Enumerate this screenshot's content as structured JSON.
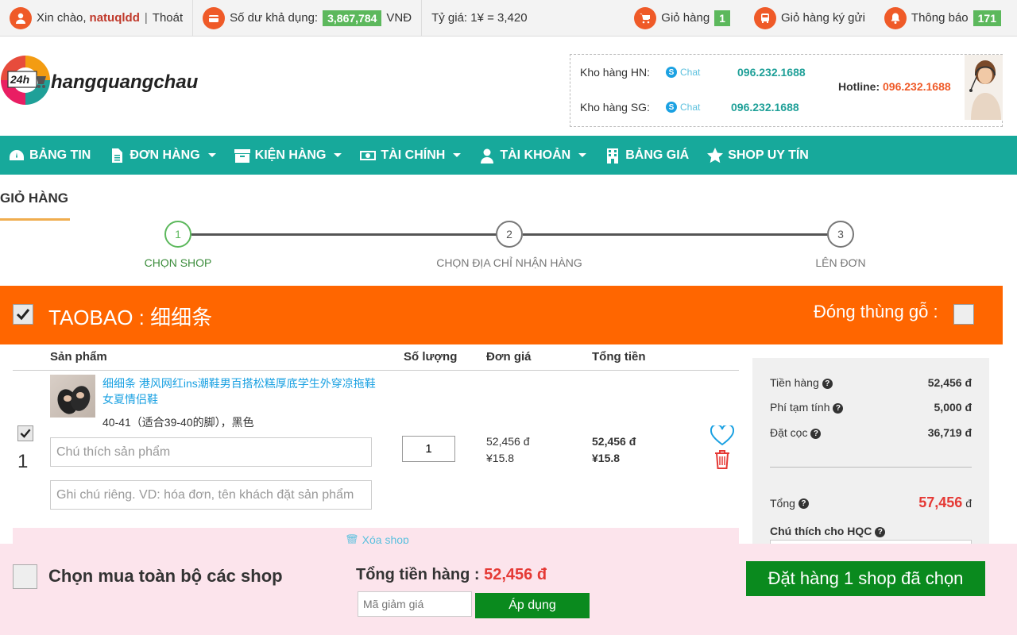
{
  "topbar": {
    "greeting": "Xin chào,",
    "username": "natuqldd",
    "logout": "Thoát",
    "balance_label": "Số dư khả dụng:",
    "balance_value": "3,867,784",
    "balance_unit": "VNĐ",
    "rate": "Tỷ giá: 1¥ = 3,420",
    "cart_label": "Giỏ hàng",
    "cart_count": "1",
    "consign_cart_label": "Giỏ hàng ký gửi",
    "notify_label": "Thông báo",
    "notify_count": "171"
  },
  "header": {
    "logo_badge": "24h",
    "logo_text": "hangquangchau",
    "kho_hn_label": "Kho hàng HN:",
    "kho_sg_label": "Kho hàng SG:",
    "chat_label": "Chat",
    "phone_hn": "096.232.1688",
    "phone_sg": "096.232.1688",
    "hotline_label": "Hotline:",
    "hotline_value": "096.232.1688"
  },
  "nav": {
    "items": [
      {
        "label": "BẢNG TIN",
        "icon": "dashboard-icon",
        "dropdown": false
      },
      {
        "label": "ĐƠN HÀNG",
        "icon": "document-icon",
        "dropdown": true
      },
      {
        "label": "KIỆN HÀNG",
        "icon": "box-icon",
        "dropdown": true
      },
      {
        "label": "TÀI CHÍNH",
        "icon": "money-icon",
        "dropdown": true
      },
      {
        "label": "TÀI KHOẢN",
        "icon": "user-icon",
        "dropdown": true
      },
      {
        "label": "BẢNG GIÁ",
        "icon": "building-icon",
        "dropdown": false
      },
      {
        "label": "SHOP UY TÍN",
        "icon": "star-icon",
        "dropdown": false
      }
    ]
  },
  "page": {
    "title": "GIỎ HÀNG"
  },
  "steps": [
    {
      "num": "1",
      "label": "CHỌN SHOP",
      "active": true
    },
    {
      "num": "2",
      "label": "CHỌN ĐỊA CHỈ NHẬN HÀNG",
      "active": false
    },
    {
      "num": "3",
      "label": "LÊN ĐƠN",
      "active": false
    }
  ],
  "shop": {
    "name": "TAOBAO : 细细条",
    "wood_label": "Đóng thùng gỗ :",
    "delete_label": "🗑 Xóa shop"
  },
  "table": {
    "col_product": "Sản phẩm",
    "col_qty": "Số lượng",
    "col_price": "Đơn giá",
    "col_total": "Tổng tiền"
  },
  "item": {
    "index": "1",
    "name": "细细条 港风网红ins潮鞋男百搭松糕厚底学生外穿凉拖鞋女夏情侣鞋",
    "variant": "40-41（适合39-40的脚），黑色",
    "note_placeholder": "Chú thích sản phẩm",
    "private_note_placeholder": "Ghi chú riêng. VD: hóa đơn, tên khách đặt sản phẩm",
    "qty": "1",
    "price_vnd": "52,456 đ",
    "price_cny": "¥15.8",
    "total_vnd": "52,456 đ",
    "total_cny": "¥15.8"
  },
  "summary": {
    "goods_label": "Tiền hàng",
    "goods_value": "52,456 đ",
    "fee_label": "Phí tạm tính",
    "fee_value": "5,000 đ",
    "deposit_label": "Đặt cọc",
    "deposit_value": "36,719 đ",
    "total_label": "Tổng",
    "total_value": "57,456",
    "total_unit": "đ",
    "note_label": "Chú thích cho HQC"
  },
  "bottom": {
    "select_all_label": "Chọn mua toàn bộ các shop",
    "total_label": "Tổng tiền hàng :",
    "total_value": "52,456 đ",
    "coupon_placeholder": "Mã giảm giá",
    "apply_label": "Áp dụng",
    "order_label": "Đặt hàng 1 shop đã chọn"
  },
  "colors": {
    "accent_orange": "#ff6600",
    "nav_teal": "#17a99b",
    "green_button": "#0a8a1e",
    "price_red": "#e53935"
  }
}
